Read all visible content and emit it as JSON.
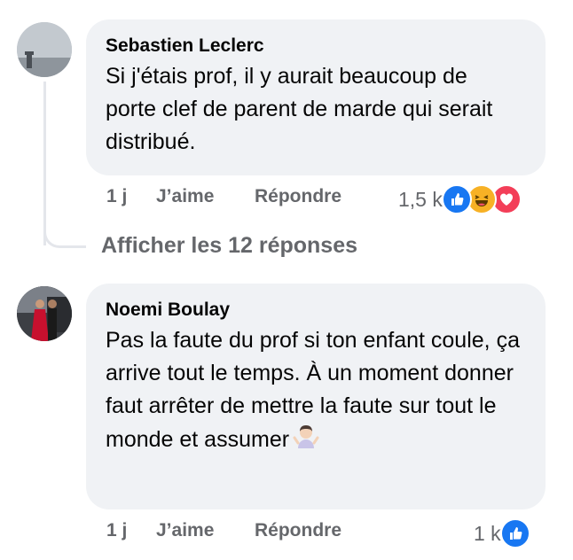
{
  "comments": [
    {
      "author": "Sebastien Leclerc",
      "text": "Si j'étais prof, il y aurait beaucoup de porte clef de parent de marde qui serait distribué.",
      "time": "1 j",
      "like_label": "J’aime",
      "reply_label": "Répondre",
      "reaction_count": "1,5 k",
      "reactions": [
        "like-icon",
        "haha-icon",
        "love-icon"
      ]
    },
    {
      "author": "Noemi Boulay",
      "text": "Pas la faute du prof si ton enfant coule, ça arrive tout le temps. À un moment donner faut arrêter de mettre la faute sur tout le monde et assumer",
      "emoji": "person-shrugging-emoji",
      "time": "1 j",
      "like_label": "J’aime",
      "reply_label": "Répondre",
      "reaction_count": "1 k",
      "reactions": [
        "like-icon"
      ]
    }
  ],
  "replies_link": "Afficher les 12 réponses",
  "colors": {
    "bubble": "#f0f2f5",
    "meta": "#65676b",
    "like": "#1877f2",
    "haha": "#f7b125",
    "love": "#f33e58"
  }
}
